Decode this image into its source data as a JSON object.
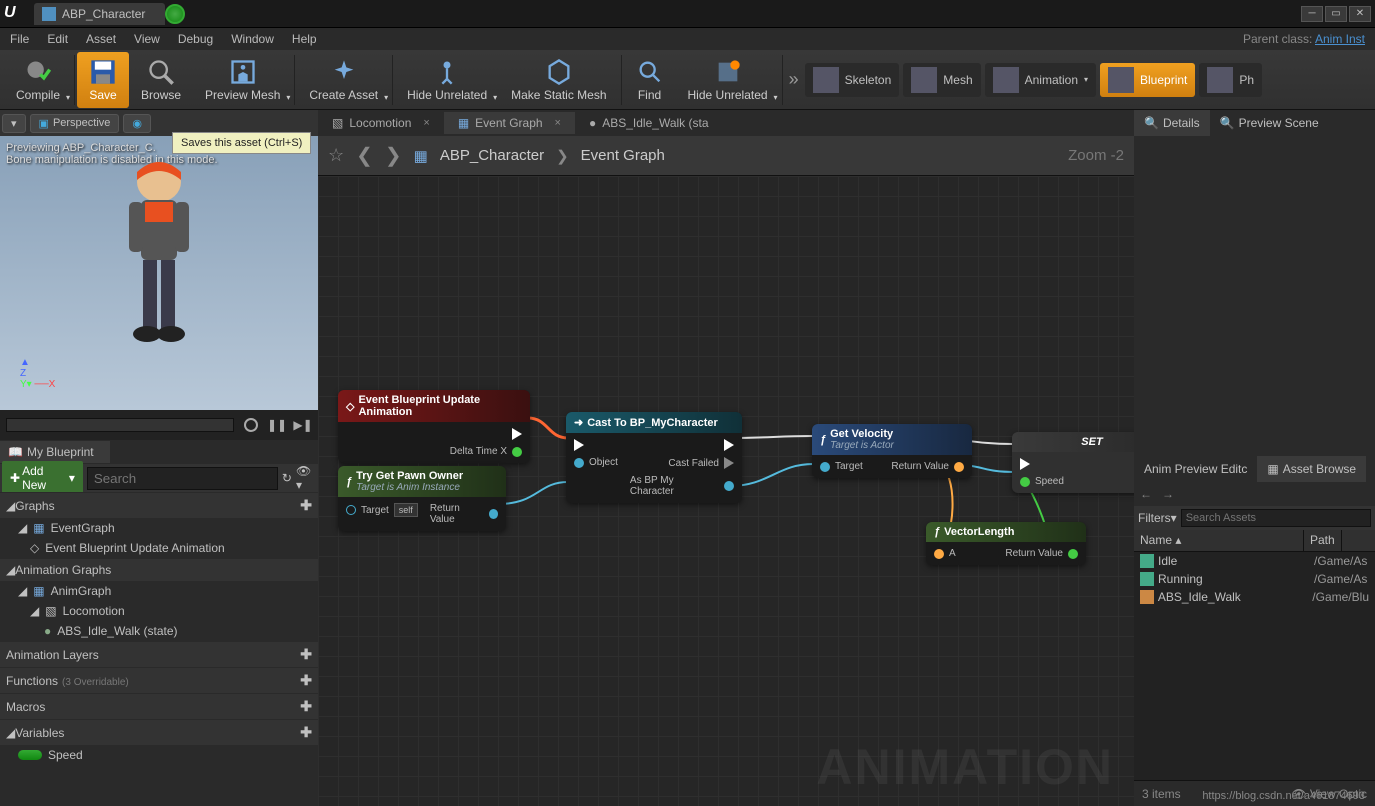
{
  "titlebar": {
    "tab": "ABP_Character"
  },
  "menubar": {
    "items": [
      "File",
      "Edit",
      "Asset",
      "View",
      "Debug",
      "Window",
      "Help"
    ],
    "parent_label": "Parent class:",
    "parent_class": "Anim Inst"
  },
  "tooltip": "Saves this asset (Ctrl+S)",
  "toolbar": {
    "compile": "Compile",
    "save": "Save",
    "browse": "Browse",
    "preview_mesh": "Preview Mesh",
    "create_asset": "Create Asset",
    "hide_unrelated": "Hide Unrelated",
    "make_static": "Make Static Mesh",
    "find": "Find",
    "hide_unrelated2": "Hide Unrelated",
    "modes": {
      "skeleton": "Skeleton",
      "mesh": "Mesh",
      "animation": "Animation",
      "blueprint": "Blueprint",
      "physics": "Ph"
    }
  },
  "viewport": {
    "perspective": "Perspective",
    "overlay1": "Previewing ABP_Character_C.",
    "overlay2": "Bone manipulation is disabled in this mode."
  },
  "mybp": {
    "title": "My Blueprint",
    "add": "Add New",
    "search_ph": "Search",
    "cats": {
      "graphs": "Graphs",
      "anim_graphs": "Animation Graphs",
      "anim_layers": "Animation Layers",
      "functions": "Functions",
      "functions_sub": "(3 Overridable)",
      "macros": "Macros",
      "variables": "Variables"
    },
    "items": {
      "event_graph": "EventGraph",
      "event_bp": "Event Blueprint Update Animation",
      "anim_graph": "AnimGraph",
      "locomotion": "Locomotion",
      "abs_idle": "ABS_Idle_Walk (state)",
      "speed": "Speed"
    }
  },
  "tabs": {
    "locomotion": "Locomotion",
    "event_graph": "Event Graph",
    "abs_idle": "ABS_Idle_Walk (sta"
  },
  "breadcrumb": {
    "asset": "ABP_Character",
    "graph": "Event Graph",
    "zoom": "Zoom -2"
  },
  "nodes": {
    "event": {
      "title": "Event Blueprint Update Animation",
      "out": "Delta Time X"
    },
    "pawn": {
      "title": "Try Get Pawn Owner",
      "sub": "Target is Anim Instance",
      "target": "Target",
      "self": "self",
      "ret": "Return Value"
    },
    "cast": {
      "title": "Cast To BP_MyCharacter",
      "obj": "Object",
      "failed": "Cast Failed",
      "as": "As BP My Character"
    },
    "vel": {
      "title": "Get Velocity",
      "sub": "Target is Actor",
      "target": "Target",
      "ret": "Return Value"
    },
    "len": {
      "title": "VectorLength",
      "a": "A",
      "ret": "Return Value"
    },
    "set": {
      "title": "SET",
      "speed": "Speed"
    }
  },
  "watermark": "ANIMATION",
  "details": {
    "tab1": "Details",
    "tab2": "Preview Scene"
  },
  "browser": {
    "tab1": "Anim Preview Editc",
    "tab2": "Asset Browse",
    "filters": "Filters",
    "search_ph": "Search Assets",
    "col_name": "Name",
    "col_path": "Path",
    "rows": [
      {
        "name": "Idle",
        "path": "/Game/As"
      },
      {
        "name": "Running",
        "path": "/Game/As"
      },
      {
        "name": "ABS_Idle_Walk",
        "path": "/Game/Blu"
      }
    ],
    "count": "3 items",
    "view": "View Optic"
  },
  "url": "https://blog.csdn.net/a461874693"
}
